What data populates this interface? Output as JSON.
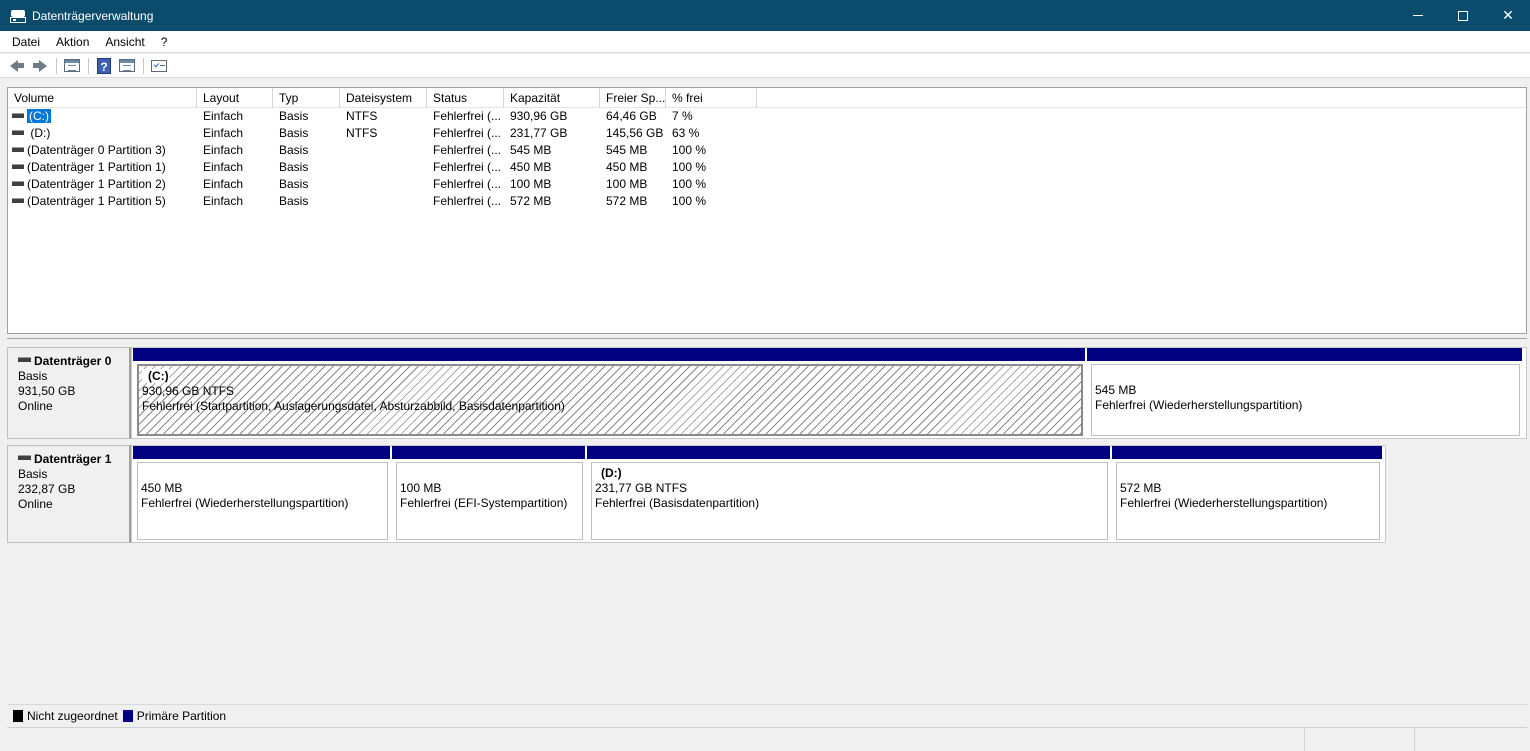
{
  "window": {
    "title": "Datenträgerverwaltung"
  },
  "menu": [
    "Datei",
    "Aktion",
    "Ansicht",
    "?"
  ],
  "toolbar": {
    "icons": [
      "back-arrow-icon",
      "forward-arrow-icon",
      "console-tree-icon",
      "help-icon",
      "show-pane-icon",
      "properties-checklist-icon"
    ]
  },
  "volume_list": {
    "columns": [
      "Volume",
      "Layout",
      "Typ",
      "Dateisystem",
      "Status",
      "Kapazität",
      "Freier Sp...",
      "% frei"
    ],
    "rows": [
      {
        "volume": "(C:)",
        "layout": "Einfach",
        "typ": "Basis",
        "fs": "NTFS",
        "status": "Fehlerfrei (...",
        "capacity": "930,96 GB",
        "free": "64,46 GB",
        "pct": "7 %"
      },
      {
        "volume": "(D:)",
        "layout": "Einfach",
        "typ": "Basis",
        "fs": "NTFS",
        "status": "Fehlerfrei (...",
        "capacity": "231,77 GB",
        "free": "145,56 GB",
        "pct": "63 %"
      },
      {
        "volume": "(Datenträger 0 Partition 3)",
        "layout": "Einfach",
        "typ": "Basis",
        "fs": "",
        "status": "Fehlerfrei (...",
        "capacity": "545 MB",
        "free": "545 MB",
        "pct": "100 %"
      },
      {
        "volume": "(Datenträger 1 Partition 1)",
        "layout": "Einfach",
        "typ": "Basis",
        "fs": "",
        "status": "Fehlerfrei (...",
        "capacity": "450 MB",
        "free": "450 MB",
        "pct": "100 %"
      },
      {
        "volume": "(Datenträger 1 Partition 2)",
        "layout": "Einfach",
        "typ": "Basis",
        "fs": "",
        "status": "Fehlerfrei (...",
        "capacity": "100 MB",
        "free": "100 MB",
        "pct": "100 %"
      },
      {
        "volume": "(Datenträger 1 Partition 5)",
        "layout": "Einfach",
        "typ": "Basis",
        "fs": "",
        "status": "Fehlerfrei (...",
        "capacity": "572 MB",
        "free": "572 MB",
        "pct": "100 %"
      }
    ]
  },
  "disks": [
    {
      "name": "Datenträger 0",
      "type": "Basis",
      "size": "931,50 GB",
      "state": "Online",
      "partitions": [
        {
          "label": "(C:)",
          "size": "930,96 GB NTFS",
          "status": "Fehlerfrei (Startpartition, Auslagerungsdatei, Absturzabbild, Basisdatenpartition)"
        },
        {
          "label": "",
          "size": "545 MB",
          "status": "Fehlerfrei (Wiederherstellungspartition)"
        }
      ]
    },
    {
      "name": "Datenträger 1",
      "type": "Basis",
      "size": "232,87 GB",
      "state": "Online",
      "partitions": [
        {
          "label": "",
          "size": "450 MB",
          "status": "Fehlerfrei (Wiederherstellungspartition)"
        },
        {
          "label": "",
          "size": "100 MB",
          "status": "Fehlerfrei (EFI-Systempartition)"
        },
        {
          "label": "(D:)",
          "size": "231,77 GB NTFS",
          "status": "Fehlerfrei (Basisdatenpartition)"
        },
        {
          "label": "",
          "size": "572 MB",
          "status": "Fehlerfrei (Wiederherstellungspartition)"
        }
      ]
    }
  ],
  "legend": [
    {
      "label": "Nicht zugeordnet",
      "color": "#000000"
    },
    {
      "label": "Primäre Partition",
      "color": "#000080"
    }
  ],
  "colors": {
    "titlebar": "#0b4c6c",
    "partition_bar": "#000080",
    "selection": "#0078d7"
  }
}
